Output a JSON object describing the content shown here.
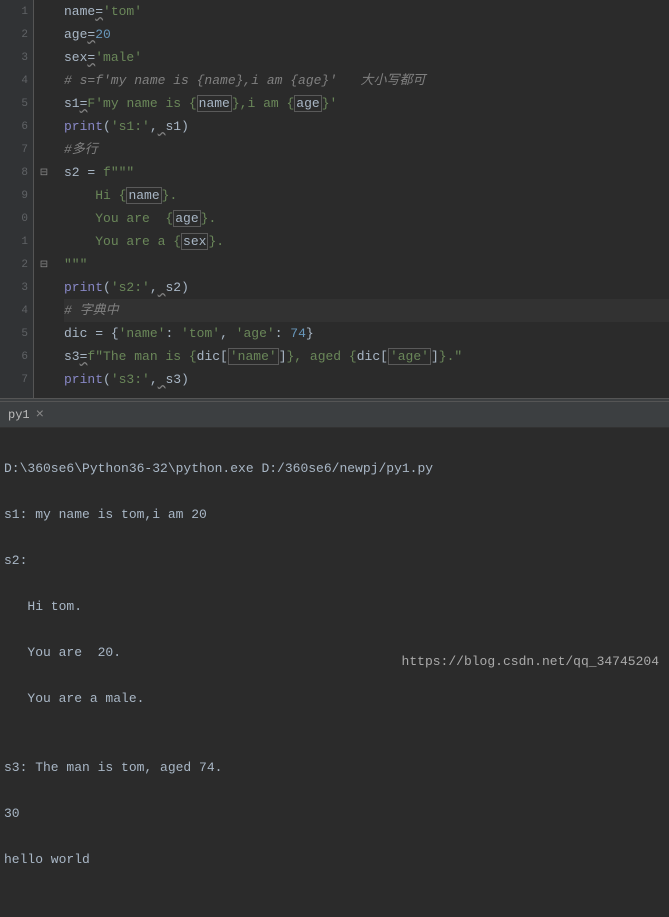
{
  "gutter_numbers": [
    "1",
    "2",
    "3",
    "4",
    "5",
    "6",
    "7",
    "8",
    "9",
    "0",
    "1",
    "2",
    "3",
    "4",
    "5",
    "6",
    "7"
  ],
  "fold_markers": {
    "7": "⊟",
    "11": "⊟"
  },
  "code": {
    "l1": {
      "var": "name",
      "eq": "=",
      "val": "'tom'"
    },
    "l2": {
      "var": "age",
      "eq": "=",
      "val": "20"
    },
    "l3": {
      "var": "sex",
      "eq": "=",
      "val": "'male'"
    },
    "l4": {
      "comment": "# s=f'my name is {name},i am {age}'   大小写都可"
    },
    "l5": {
      "var": "s1",
      "eq": "=",
      "prefix": "F",
      "str1": "'my name is {",
      "bvar1": "name",
      "str2": "},i am {",
      "bvar2": "age",
      "str3": "}'"
    },
    "l6": {
      "func": "print",
      "paren": "(",
      "arg1": "'s1:'",
      "comma": ",",
      "warn": " ",
      "arg2": "s1",
      "close": ")"
    },
    "l7": {
      "comment": "#多行"
    },
    "l8": {
      "var": "s2 = ",
      "prefix": "f",
      "str": "\"\"\""
    },
    "l9": {
      "indent": "    ",
      "str1": "Hi {",
      "bvar": "name",
      "str2": "}."
    },
    "l10": {
      "indent": "    ",
      "str1": "You are  {",
      "bvar": "age",
      "str2": "}."
    },
    "l11": {
      "indent": "    ",
      "str1": "You are a {",
      "bvar": "sex",
      "str2": "}."
    },
    "l12": {
      "indent": "",
      "str": "\"\"\""
    },
    "l13": {
      "func": "print",
      "paren": "(",
      "arg1": "'s2:'",
      "comma": ",",
      "warn": " ",
      "arg2": "s2",
      "close": ")"
    },
    "l14": {
      "comment": "# 字典中"
    },
    "l15": {
      "var": "dic = ",
      "brace": "{",
      "k1": "'name'",
      "c1": ": ",
      "v1": "'tom'",
      "comma": ", ",
      "k2": "'age'",
      "c2": ": ",
      "v2": "74",
      "close": "}"
    },
    "l16": {
      "var": "s3",
      "eq": "=",
      "prefix": "f",
      "str1": "\"The man is {",
      "dvar1": "dic[",
      "dkey1": "'name'",
      "dclose1": "]",
      "str2": "}, aged {",
      "dvar2": "dic[",
      "dkey2": "'age'",
      "dclose2": "]",
      "str3": "}.\""
    },
    "l17": {
      "func": "print",
      "paren": "(",
      "arg1": "'s3:'",
      "comma": ",",
      "warn": " ",
      "arg2": "s3",
      "close": ")"
    }
  },
  "tab": {
    "label": "py1",
    "close": "×"
  },
  "console": {
    "l1": "D:\\360se6\\Python36-32\\python.exe D:/360se6/newpj/py1.py",
    "l2": "s1: my name is tom,i am 20",
    "l3": "s2:",
    "l4": "   Hi tom.",
    "l5": "   You are  20.",
    "l6": "   You are a male.",
    "l7": "",
    "l8": "s3: The man is tom, aged 74.",
    "l9": "30",
    "l10": "hello world"
  },
  "watermark": "https://blog.csdn.net/qq_34745204"
}
